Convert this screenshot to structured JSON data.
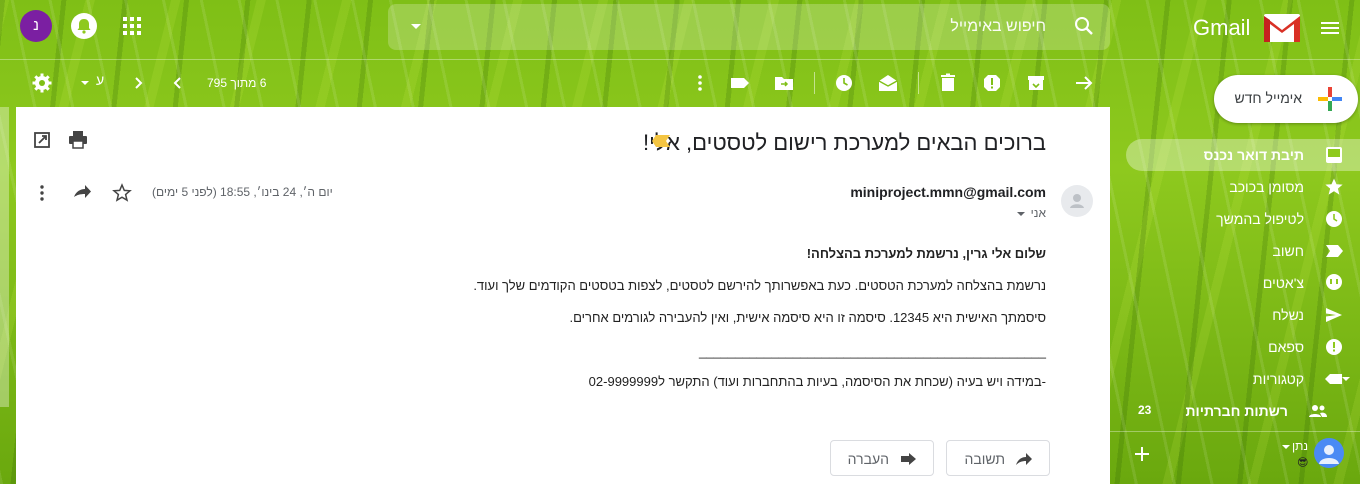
{
  "header": {
    "app_name": "Gmail",
    "search_placeholder": "חיפוש באימייל",
    "account_initial": "נ"
  },
  "toolbar": {
    "page_count": "6 מתוך 795",
    "language_key": "ע"
  },
  "compose": {
    "label": "אימייל חדש"
  },
  "sidebar": {
    "items": [
      {
        "label": "תיבת דואר נכנס",
        "icon": "inbox-icon",
        "active": true
      },
      {
        "label": "מסומן בכוכב",
        "icon": "star-icon"
      },
      {
        "label": "לטיפול בהמשך",
        "icon": "clock-icon"
      },
      {
        "label": "חשוב",
        "icon": "important-icon"
      },
      {
        "label": "צ'אטים",
        "icon": "chat-icon"
      },
      {
        "label": "נשלח",
        "icon": "send-icon"
      },
      {
        "label": "ספאם",
        "icon": "spam-icon"
      },
      {
        "label": "קטגוריות",
        "icon": "label-icon"
      },
      {
        "label": "רשתות חברתיות",
        "icon": "people-icon",
        "count": "23"
      }
    ],
    "hangouts": {
      "name": "נתן",
      "status_emoji": "😎"
    }
  },
  "email": {
    "subject": "ברוכים הבאים למערכת רישום לטסטים, אלי!",
    "sender": "miniproject.mmn@gmail.com",
    "recipient": "אני",
    "date": "יום ה׳, 24 בינו׳, 18:55 (לפני 5 ימים)",
    "body": {
      "greeting": "שלום אלי גרין, נרשמת למערכת בהצלחה!",
      "line1": "נרשמת בהצלחה למערכת הטסטים. כעת באפשרותך להירשם לטסטים, לצפות בטסטים הקודמים שלך ועוד.",
      "line2": "סיסמתך האישית היא 12345. סיסמה זו היא סיסמה אישית, ואין להעבירה לגורמים אחרים.",
      "separator": "________________________________________________",
      "line3": "-במידה ויש בעיה (שכחת את הסיסמה, בעיות בהתחברות ועוד) התקשר ל02-9999999"
    },
    "actions": {
      "reply": "תשובה",
      "forward": "העברה"
    }
  },
  "colors": {
    "accent": "#7b1fa2",
    "label_marker": "#f4c542"
  }
}
